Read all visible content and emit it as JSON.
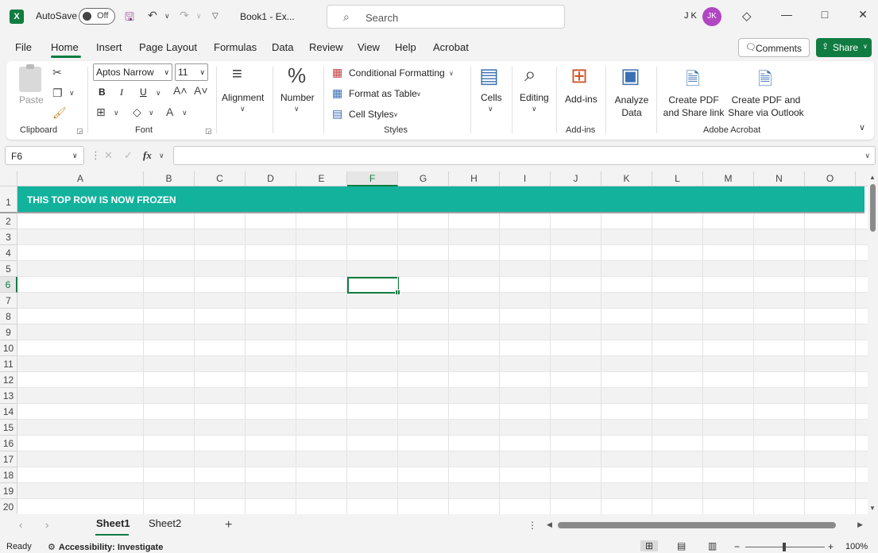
{
  "app": {
    "logo": "X",
    "autosave_label": "AutoSave",
    "autosave_state": "Off",
    "doc_title": "Book1 - Ex...",
    "search_placeholder": "Search",
    "user_initials": "J K",
    "avatar_initials": "JK",
    "brand_color": "#107c41"
  },
  "menu": {
    "tabs": [
      "File",
      "Home",
      "Insert",
      "Page Layout",
      "Formulas",
      "Data",
      "Review",
      "View",
      "Help",
      "Acrobat"
    ],
    "active_tab": "Home",
    "comments_label": "Comments",
    "share_label": "Share"
  },
  "ribbon": {
    "clipboard": {
      "paste": "Paste",
      "label": "Clipboard"
    },
    "font": {
      "name": "Aptos Narrow",
      "size": "11",
      "label": "Font",
      "bold": "B",
      "italic": "I",
      "underline": "U"
    },
    "alignment": {
      "label": "Alignment"
    },
    "number": {
      "label": "Number",
      "icon_glyph": "%"
    },
    "styles": {
      "conditional": "Conditional Formatting",
      "format_table": "Format as Table",
      "cell_styles": "Cell Styles",
      "label": "Styles"
    },
    "cells": {
      "label": "Cells"
    },
    "editing": {
      "label": "Editing"
    },
    "addins": {
      "button": "Add-ins",
      "label": "Add-ins"
    },
    "analyze": {
      "line1": "Analyze",
      "line2": "Data"
    },
    "acrobat": {
      "pdf_share_line1": "Create PDF",
      "pdf_share_line2": "and Share link",
      "pdf_outlook_line1": "Create PDF and",
      "pdf_outlook_line2": "Share via Outlook",
      "label": "Adobe Acrobat"
    }
  },
  "formula_bar": {
    "name_box": "F6",
    "fx": "fx",
    "value": ""
  },
  "grid": {
    "columns": [
      "A",
      "B",
      "C",
      "D",
      "E",
      "F",
      "G",
      "H",
      "I",
      "J",
      "K",
      "L",
      "M",
      "N",
      "O"
    ],
    "selected_column": "F",
    "rows": [
      "1",
      "2",
      "3",
      "4",
      "5",
      "6",
      "7",
      "8",
      "9",
      "10",
      "11",
      "12",
      "13",
      "14",
      "15",
      "16",
      "17",
      "18",
      "19",
      "20"
    ],
    "selected_row": "6",
    "frozen_row_text": "THIS TOP ROW IS NOW FROZEN",
    "frozen_row_color": "#12b29c"
  },
  "sheets": {
    "tabs": [
      "Sheet1",
      "Sheet2"
    ],
    "active": "Sheet1"
  },
  "status": {
    "ready": "Ready",
    "accessibility": "Accessibility: Investigate",
    "zoom": "100%"
  }
}
